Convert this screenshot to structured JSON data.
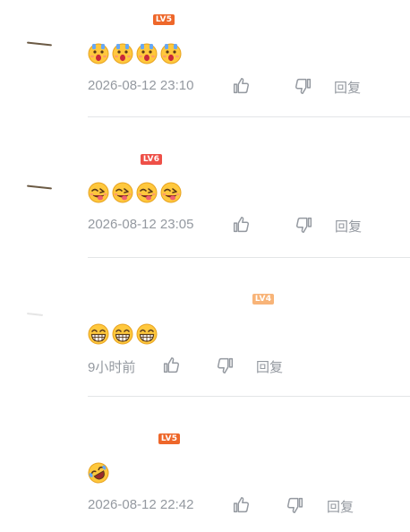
{
  "comments": [
    {
      "username": "",
      "level": "LV5",
      "emoji_count": 4,
      "emoji": "scream-face",
      "time": "2026-08-12 23:10",
      "like_count": "",
      "reply_label": "回复"
    },
    {
      "username": "",
      "level": "LV6",
      "emoji_count": 4,
      "emoji": "tongue-wink-face",
      "time": "2026-08-12 23:05",
      "like_count": "",
      "reply_label": "回复"
    },
    {
      "username": "",
      "level": "LV4",
      "emoji_count": 3,
      "emoji": "grin-face",
      "time": "9小时前",
      "like_count": "",
      "reply_label": "回复"
    },
    {
      "username": "",
      "level": "LV5",
      "emoji_count": 1,
      "emoji": "laugh-cry-face",
      "time": "2026-08-12 22:42",
      "like_count": "",
      "reply_label": "回复"
    }
  ],
  "icons": {
    "like": "thumbs-up-icon",
    "dislike": "thumbs-down-icon"
  },
  "colors": {
    "meta_text": "#9499a0",
    "divider": "#e3e5e7",
    "lv4": "#f8b478",
    "lv5": "#ee672a",
    "lv6": "#ee5048",
    "emoji_yellow": "#ffc83d"
  }
}
